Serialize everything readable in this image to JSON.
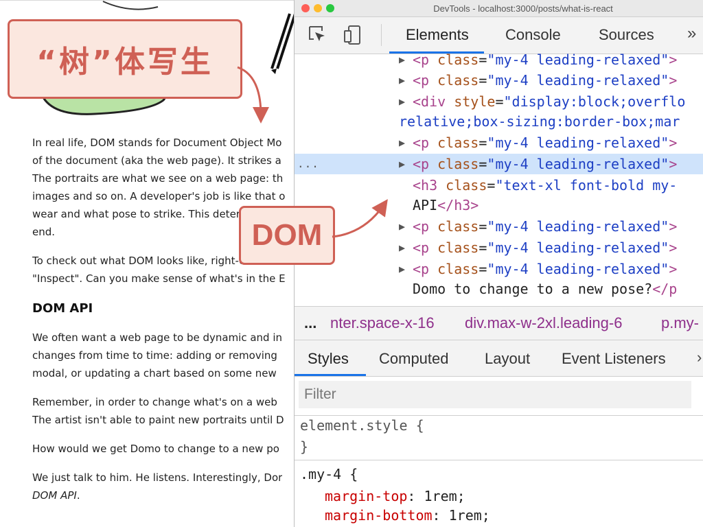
{
  "annotations": {
    "chinese_label": "“树”体写生",
    "dom_label": "DOM",
    "accent_color": "#cf6055",
    "fill_color": "#fbe7df"
  },
  "article": {
    "lines": [
      "In real life, DOM stands for Document Object Mo",
      "of the document (aka the web page). It strikes a",
      "The portraits are what we see on a web page: th",
      "images and so on. A developer's job is like that o",
      "wear and what pose to strike. This determines w",
      "end.",
      "To check out what DOM looks like, right-click on",
      "\"Inspect\". Can you make sense of what's in the E",
      "We often want a web page to be dynamic and in",
      "changes from time to time: adding or removing",
      "modal, or updating a chart based on some new",
      "Remember, in order to change what's on a web",
      "The artist isn't able to paint new portraits until D",
      "How would we get Domo to change to a new po",
      "We just talk to him. He listens. Interestingly, Dor"
    ],
    "heading": "DOM API",
    "italic_tail": "DOM API",
    "italic_tail_after": "."
  },
  "devtools": {
    "window_title": "DevTools - localhost:3000/posts/what-is-react",
    "tabs": [
      "Elements",
      "Console",
      "Sources"
    ],
    "more_tabs": "»",
    "tree": [
      {
        "tag": "<p",
        "attr": "class",
        "val": "\"my-4 leading-relaxed\"",
        "tail": ">"
      },
      {
        "tag": "<p",
        "attr": "class",
        "val": "\"my-4 leading-relaxed\"",
        "tail": ">"
      },
      {
        "tag": "<div",
        "attr": "style",
        "val": "\"display:block;overflo"
      },
      {
        "cont": "relative;box-sizing:border-box;mar"
      },
      {
        "tag": "<p",
        "attr": "class",
        "val": "\"my-4 leading-relaxed\"",
        "tail": ">"
      },
      {
        "tag": "<p",
        "attr": "class",
        "val": "\"my-4 leading-relaxed\"",
        "tail": ">"
      },
      {
        "tag": "<h3",
        "attr": "class",
        "val": "\"text-xl font-bold my-"
      },
      {
        "text": "API",
        "close": "</h3>"
      },
      {
        "tag": "<p",
        "attr": "class",
        "val": "\"my-4 leading-relaxed\"",
        "tail": ">"
      },
      {
        "tag": "<p",
        "attr": "class",
        "val": "\"my-4 leading-relaxed\"",
        "tail": ">"
      },
      {
        "tag": "<p",
        "attr": "class",
        "val": "\"my-4 leading-relaxed\"",
        "tail": ">"
      },
      {
        "text": "Domo to change to a new pose?",
        "close": "</p"
      }
    ],
    "tree_eq": "=",
    "row_dots": "...",
    "breadcrumb": {
      "more": "...",
      "items": [
        "nter.space-x-16",
        "div.max-w-2xl.leading-6",
        "p.my-"
      ]
    },
    "style_tabs": [
      "Styles",
      "Computed",
      "Layout",
      "Event Listeners"
    ],
    "style_tabs_more": "›",
    "filter_placeholder": "Filter",
    "styles": {
      "element_style_open": "element.style {",
      "element_style_close": "}",
      "selector": ".my-4",
      "brace": "{",
      "props": [
        {
          "name": "margin-top",
          "value": "1rem;"
        },
        {
          "name": "margin-bottom",
          "value": "1rem;"
        }
      ],
      "colon": ":"
    },
    "colors": {
      "tag": "#a8438c",
      "attr": "#a5511b",
      "value": "#1d3fc4",
      "selected_row": "#cfe3fb",
      "tab_underline": "#1a73e8",
      "css_prop": "#c80000"
    }
  }
}
